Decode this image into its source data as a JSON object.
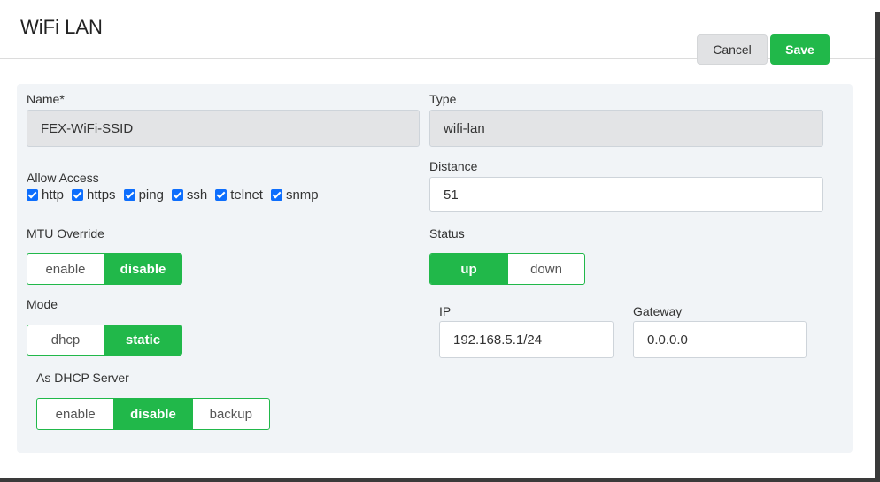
{
  "header": {
    "title": "WiFi LAN",
    "cancel_label": "Cancel",
    "save_label": "Save"
  },
  "form": {
    "name": {
      "label": "Name*",
      "value": "FEX-WiFi-SSID"
    },
    "type": {
      "label": "Type",
      "value": "wifi-lan"
    },
    "allow_access": {
      "label": "Allow Access",
      "options": [
        {
          "label": "http",
          "checked": true
        },
        {
          "label": "https",
          "checked": true
        },
        {
          "label": "ping",
          "checked": true
        },
        {
          "label": "ssh",
          "checked": true
        },
        {
          "label": "telnet",
          "checked": true
        },
        {
          "label": "snmp",
          "checked": true
        }
      ]
    },
    "distance": {
      "label": "Distance",
      "value": "51"
    },
    "mtu_override": {
      "label": "MTU Override",
      "options": [
        "enable",
        "disable"
      ],
      "selected": "disable"
    },
    "status": {
      "label": "Status",
      "options": [
        "up",
        "down"
      ],
      "selected": "up"
    },
    "mode": {
      "label": "Mode",
      "options": [
        "dhcp",
        "static"
      ],
      "selected": "static"
    },
    "ip": {
      "label": "IP",
      "value": "192.168.5.1/24"
    },
    "gateway": {
      "label": "Gateway",
      "value": "0.0.0.0"
    },
    "dhcp_server": {
      "label": "As DHCP Server",
      "options": [
        "enable",
        "disable",
        "backup"
      ],
      "selected": "disable"
    }
  },
  "colors": {
    "accent": "#21b84a",
    "checkbox": "#0d6efd",
    "panel": "#f1f4f7"
  }
}
